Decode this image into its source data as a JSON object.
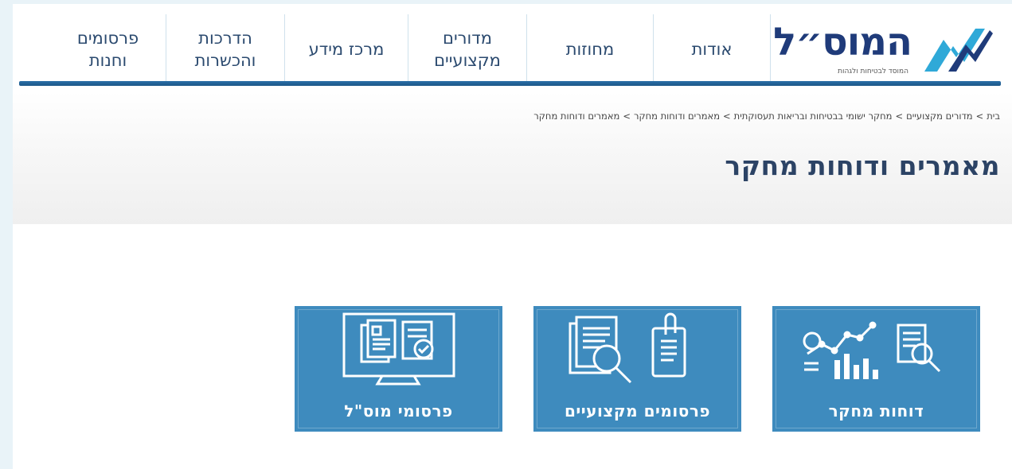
{
  "brand": {
    "name": "המוס״ל",
    "tagline": "המוסד לבטיחות ולגהות",
    "colors": {
      "primary": "#1f3b7a",
      "accent_cyan": "#2fa9d8",
      "tile": "#3e8bbe"
    }
  },
  "nav": {
    "items": [
      {
        "id": "about",
        "lines": [
          "אודות"
        ]
      },
      {
        "id": "exhibitions",
        "lines": [
          "מחוזות"
        ]
      },
      {
        "id": "professional",
        "lines": [
          "מדורים",
          "מקצועיים"
        ]
      },
      {
        "id": "info",
        "lines": [
          "מרכז מידע"
        ]
      },
      {
        "id": "training",
        "lines": [
          "הדרכות",
          "והכשרות"
        ]
      },
      {
        "id": "publications",
        "lines": [
          "פרסומים",
          "וחנות"
        ]
      }
    ]
  },
  "breadcrumb": {
    "items": [
      "בית",
      "מדורים מקצועיים",
      "מחקר ישומי בבטיחות ובריאות תעסוקתית",
      "מאמרים ודוחות מחקר",
      "מאמרים ודוחות מחקר"
    ],
    "separator": ">"
  },
  "page": {
    "title": "מאמרים ודוחות מחקר"
  },
  "tiles": [
    {
      "id": "research-reports",
      "label": "דוחות מחקר",
      "icon": "chart-and-magnifier-icon"
    },
    {
      "id": "professional-publications",
      "label": "פרסומים מקצועיים",
      "icon": "documents-magnifier-icon"
    },
    {
      "id": "mosal-publications",
      "label": "פרסומי מוס\"ל",
      "icon": "monitor-documents-icon"
    }
  ]
}
